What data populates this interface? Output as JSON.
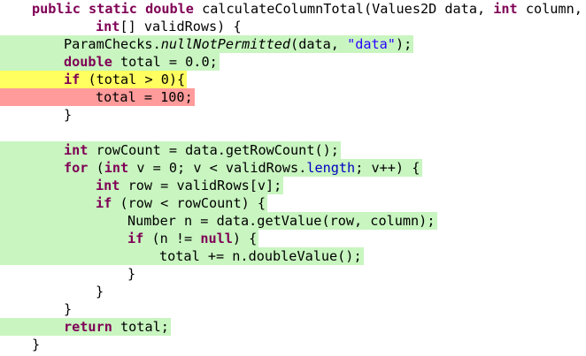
{
  "colors": {
    "covered": "#c8f5c0",
    "partial": "#ffff60",
    "missed": "#ff9b9b",
    "keyword": "#7f0055",
    "string": "#2a00ff",
    "field": "#0000c0"
  },
  "lines": [
    {
      "status": "none",
      "indent": 1,
      "tokens": [
        {
          "t": "public",
          "s": "kw"
        },
        {
          "t": " "
        },
        {
          "t": "static",
          "s": "kw"
        },
        {
          "t": " "
        },
        {
          "t": "double",
          "s": "kw"
        },
        {
          "t": " calculateColumnTotal(Values2D data, "
        },
        {
          "t": "int",
          "s": "kw"
        },
        {
          "t": " column,"
        }
      ]
    },
    {
      "status": "none",
      "indent": 3,
      "tokens": [
        {
          "t": "int",
          "s": "kw"
        },
        {
          "t": "[] validRows) {"
        }
      ]
    },
    {
      "status": "covered",
      "indent": 2,
      "tokens": [
        {
          "t": "ParamChecks."
        },
        {
          "t": "nullNotPermitted",
          "s": "it"
        },
        {
          "t": "(data, "
        },
        {
          "t": "\"data\"",
          "s": "str"
        },
        {
          "t": ");"
        }
      ]
    },
    {
      "status": "covered",
      "indent": 2,
      "tokens": [
        {
          "t": "double",
          "s": "kw"
        },
        {
          "t": " total = 0.0;"
        }
      ]
    },
    {
      "status": "partial",
      "indent": 2,
      "tokens": [
        {
          "t": "if",
          "s": "kw"
        },
        {
          "t": " (total > 0){"
        }
      ]
    },
    {
      "status": "missed",
      "indent": 3,
      "tokens": [
        {
          "t": "total = 100;"
        }
      ]
    },
    {
      "status": "none",
      "indent": 2,
      "tokens": [
        {
          "t": "}"
        }
      ]
    },
    {
      "status": "none",
      "indent": 0,
      "tokens": []
    },
    {
      "status": "covered",
      "indent": 2,
      "tokens": [
        {
          "t": "int",
          "s": "kw"
        },
        {
          "t": " rowCount = data.getRowCount();"
        }
      ]
    },
    {
      "status": "covered",
      "indent": 2,
      "tokens": [
        {
          "t": "for",
          "s": "kw"
        },
        {
          "t": " ("
        },
        {
          "t": "int",
          "s": "kw"
        },
        {
          "t": " v = 0; v < validRows."
        },
        {
          "t": "length",
          "s": "fld"
        },
        {
          "t": "; v++) {"
        }
      ]
    },
    {
      "status": "covered",
      "indent": 3,
      "tokens": [
        {
          "t": "int",
          "s": "kw"
        },
        {
          "t": " row = validRows[v];"
        }
      ]
    },
    {
      "status": "covered",
      "indent": 3,
      "tokens": [
        {
          "t": "if",
          "s": "kw"
        },
        {
          "t": " (row < rowCount) {"
        }
      ]
    },
    {
      "status": "covered",
      "indent": 4,
      "tokens": [
        {
          "t": "Number n = data.getValue(row, column);"
        }
      ]
    },
    {
      "status": "covered",
      "indent": 4,
      "tokens": [
        {
          "t": "if",
          "s": "kw"
        },
        {
          "t": " (n != "
        },
        {
          "t": "null",
          "s": "kw"
        },
        {
          "t": ") {"
        }
      ]
    },
    {
      "status": "covered",
      "indent": 5,
      "tokens": [
        {
          "t": "total += n.doubleValue();"
        }
      ]
    },
    {
      "status": "none",
      "indent": 4,
      "tokens": [
        {
          "t": "}"
        }
      ]
    },
    {
      "status": "none",
      "indent": 3,
      "tokens": [
        {
          "t": "}"
        }
      ]
    },
    {
      "status": "none",
      "indent": 2,
      "tokens": [
        {
          "t": "}"
        }
      ]
    },
    {
      "status": "covered",
      "indent": 2,
      "tokens": [
        {
          "t": "return",
          "s": "kw"
        },
        {
          "t": " total;"
        }
      ]
    },
    {
      "status": "none",
      "indent": 1,
      "tokens": [
        {
          "t": "}"
        }
      ]
    }
  ]
}
